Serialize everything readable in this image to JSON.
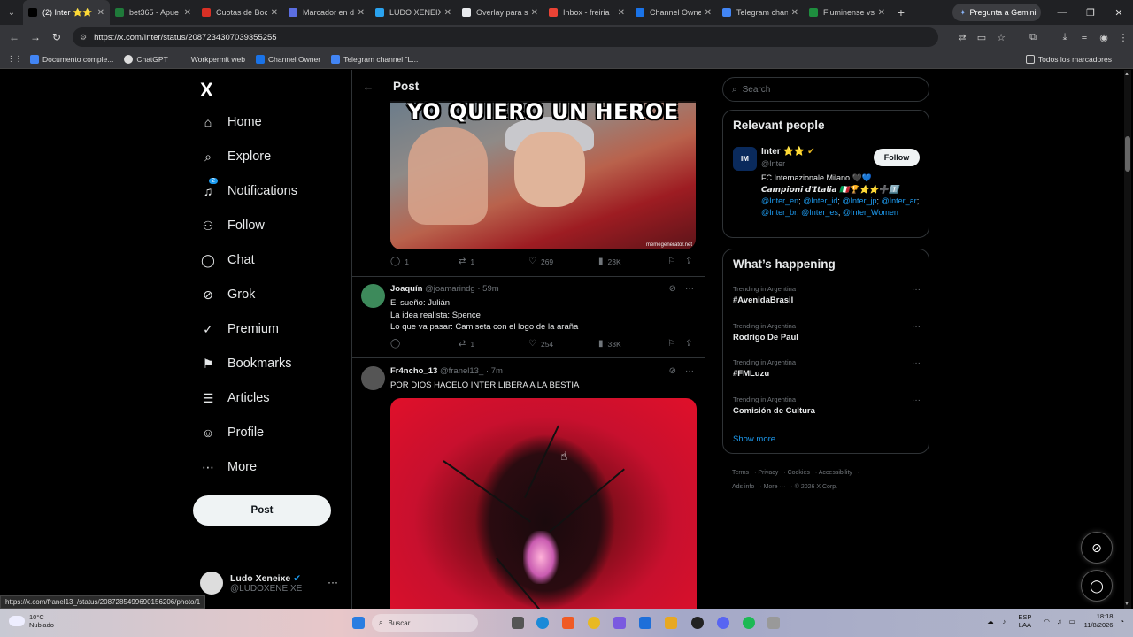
{
  "browser": {
    "tabs": [
      {
        "title": "(2) Inter ⭐⭐",
        "color": "#000000"
      },
      {
        "title": "bet365 - Apue",
        "color": "#1f7a3a"
      },
      {
        "title": "Cuotas de Boc",
        "color": "#d93025"
      },
      {
        "title": "Marcador en d",
        "color": "#5b6ee1"
      },
      {
        "title": "LUDO XENEIXE",
        "color": "#2aa3ef"
      },
      {
        "title": "Overlay para s",
        "color": "#e8eaed"
      },
      {
        "title": "Inbox - freiria",
        "color": "#ea4335"
      },
      {
        "title": "Channel Owne",
        "color": "#1a73e8"
      },
      {
        "title": "Telegram chan",
        "color": "#4285f4"
      },
      {
        "title": "Fluminense vs",
        "color": "#1e8e3e"
      }
    ],
    "gemini_label": "Pregunta a Gemini",
    "url": "https://x.com/Inter/status/2087234307039355255",
    "bookmarks": [
      "Documento comple...",
      "ChatGPT",
      "Workpermit web",
      "Channel Owner",
      "Telegram channel \"L..."
    ],
    "bookmarks_right": "Todos los marcadores",
    "status_url": "https://x.com/franel13_/status/2087285499690156206/photo/1"
  },
  "sidebar": {
    "logo": "X",
    "items": [
      {
        "label": "Home",
        "icon": "⌂"
      },
      {
        "label": "Explore",
        "icon": "⌕"
      },
      {
        "label": "Notifications",
        "icon": "♫",
        "badge": "2"
      },
      {
        "label": "Follow",
        "icon": "⚇"
      },
      {
        "label": "Chat",
        "icon": "◯"
      },
      {
        "label": "Grok",
        "icon": "⊘"
      },
      {
        "label": "Premium",
        "icon": "✓"
      },
      {
        "label": "Bookmarks",
        "icon": "⚑"
      },
      {
        "label": "Articles",
        "icon": "☰"
      },
      {
        "label": "Profile",
        "icon": "☺"
      },
      {
        "label": "More",
        "icon": "⋯"
      }
    ],
    "post_button": "Post",
    "account": {
      "name": "Ludo Xeneixe",
      "handle": "@LUDOXENEIXE",
      "more": "···"
    }
  },
  "main": {
    "header": "Post",
    "meme1": {
      "caption": "YO QUIERO UN HEROE",
      "watermark": "memegenerator.net"
    },
    "actions1": {
      "replies": "1",
      "reposts": "1",
      "likes": "269",
      "views": "23K"
    },
    "tweet2": {
      "name": "Joaquín",
      "handle": "@joamarindg",
      "time": "59m",
      "text": "El sueño: Julián\nLa idea realista: Spence\nLo que va pasar: Camiseta con el logo de la araña",
      "actions": {
        "replies": "",
        "reposts": "1",
        "likes": "254",
        "views": "33K"
      }
    },
    "tweet3": {
      "name": "Fr4ncho_13",
      "handle": "@franel13_",
      "time": "7m",
      "text": "POR DIOS HACELO INTER LIBERA A LA BESTIA"
    }
  },
  "right": {
    "search_placeholder": "Search",
    "relevant": {
      "title": "Relevant people",
      "name": "Inter ⭐⭐",
      "handle": "@Inter",
      "follow": "Follow",
      "bio_line1": "FC Internazionale Milano 🖤💙",
      "bio_line2": "𝘾𝙖𝙢𝙥𝙞𝙤𝙣𝙞 𝙙'𝙄𝙩𝙖𝙡𝙞𝙖 🇮🇹🏆⭐⭐➕1️⃣",
      "links": [
        "@Inter_en",
        "@Inter_id",
        "@Inter_jp",
        "@Inter_ar",
        "@Inter_br",
        "@Inter_es",
        "@Inter_Women"
      ]
    },
    "happening": {
      "title": "What’s happening",
      "trends": [
        {
          "context": "Trending in Argentina",
          "topic": "#AvenidaBrasil"
        },
        {
          "context": "Trending in Argentina",
          "topic": "Rodrigo De Paul"
        },
        {
          "context": "Trending in Argentina",
          "topic": "#FMLuzu"
        },
        {
          "context": "Trending in Argentina",
          "topic": "Comisión de Cultura"
        }
      ],
      "show_more": "Show more"
    },
    "footer": [
      "Terms",
      "Privacy",
      "Cookies",
      "Accessibility",
      "Ads info",
      "More ···",
      "© 2026 X Corp."
    ]
  },
  "taskbar": {
    "weather_temp": "10°C",
    "weather_desc": "Nublado",
    "search": "Buscar",
    "lang1": "ESP",
    "lang2": "LAA",
    "time": "18:18",
    "date": "11/8/2026"
  }
}
